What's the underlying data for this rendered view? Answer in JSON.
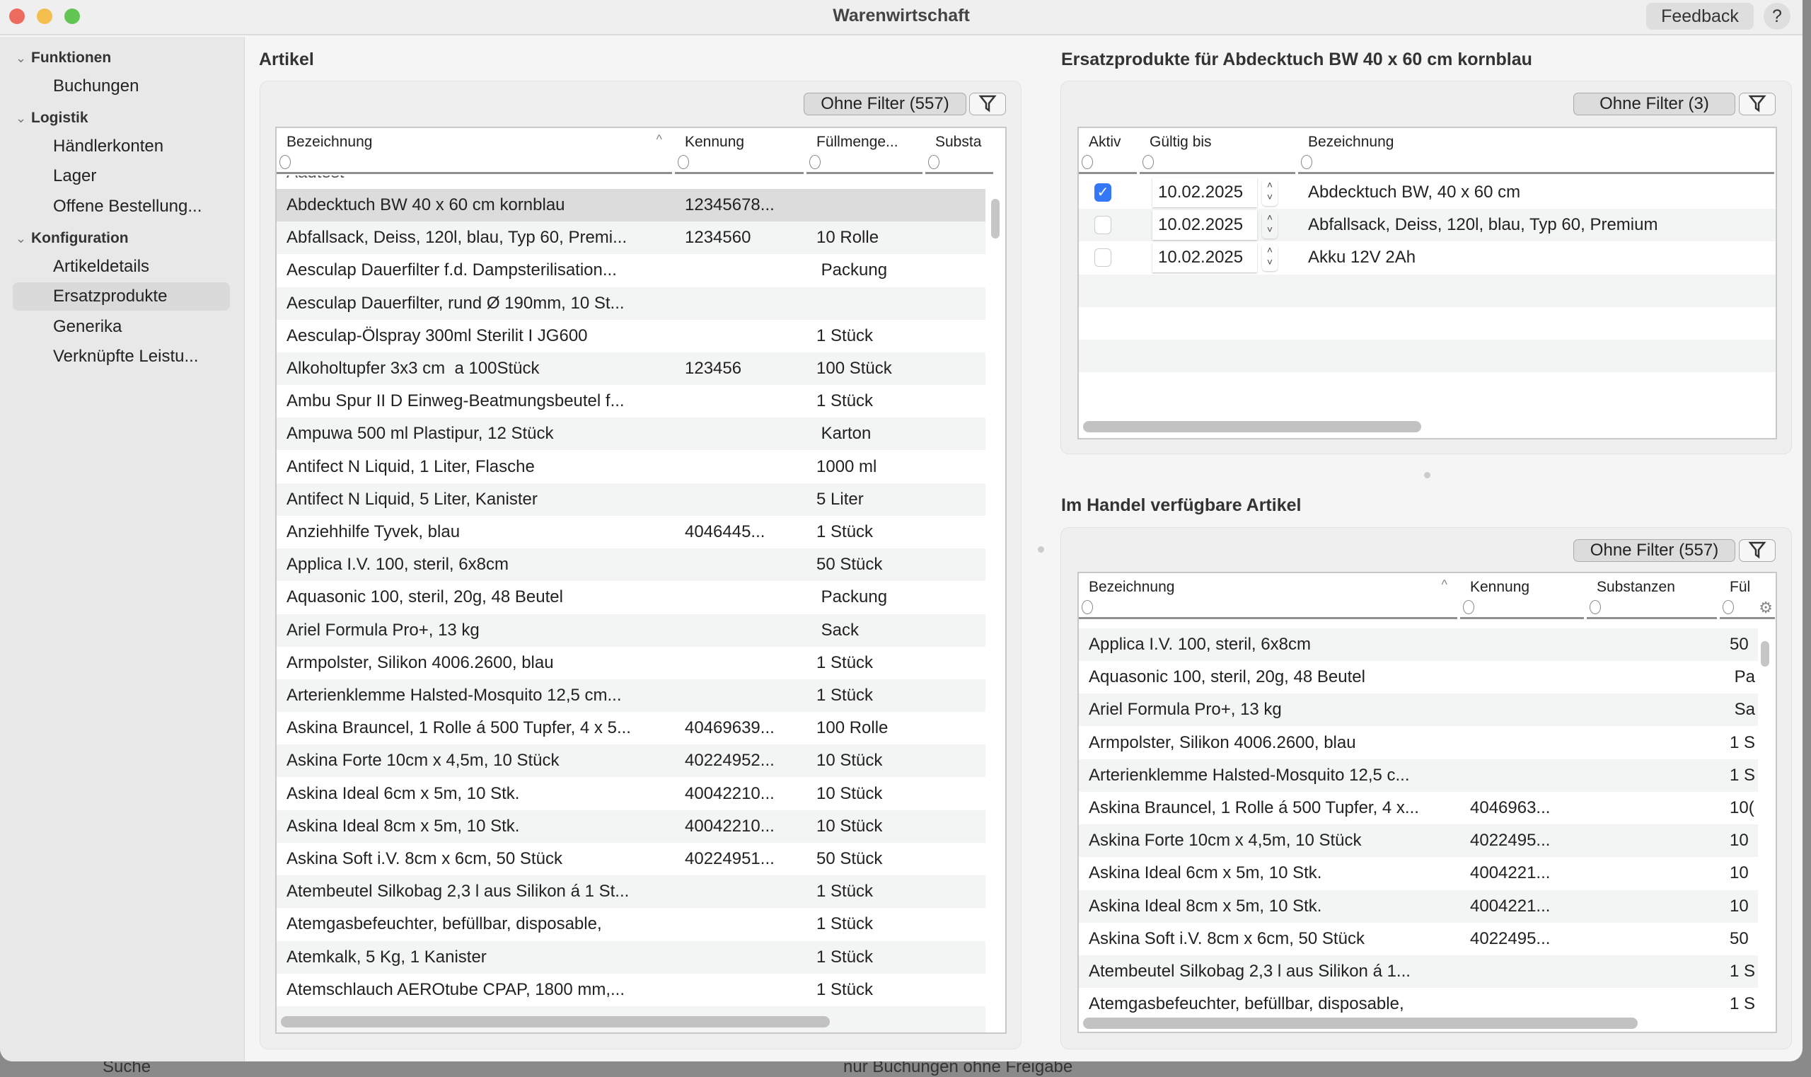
{
  "window": {
    "title": "Warenwirtschaft",
    "feedback_label": "Feedback",
    "help_label": "?"
  },
  "sidebar": {
    "groups": [
      {
        "label": "Funktionen",
        "items": [
          "Buchungen"
        ]
      },
      {
        "label": "Logistik",
        "items": [
          "Händlerkonten",
          "Lager",
          "Offene Bestellung..."
        ]
      },
      {
        "label": "Konfiguration",
        "items": [
          "Artikeldetails",
          "Ersatzprodukte",
          "Generika",
          "Verknüpfte Leistu..."
        ]
      }
    ],
    "selected": "Ersatzprodukte"
  },
  "artikel": {
    "heading": "Artikel",
    "filter_label": "Ohne Filter (557)",
    "columns": [
      "Bezeichnung",
      "Kennung",
      "Füllmenge...",
      "Substa"
    ],
    "partial_row": "Aadtest",
    "selected_index": 0,
    "rows": [
      [
        "Abdecktuch BW 40 x 60 cm kornblau",
        "12345678...",
        ""
      ],
      [
        "Abfallsack, Deiss, 120l, blau, Typ 60, Premi...",
        "1234560",
        "10 Rolle"
      ],
      [
        "Aesculap Dauerfilter f.d. Dampsterilisation...",
        "",
        " Packung"
      ],
      [
        "Aesculap Dauerfilter, rund Ø 190mm, 10 St...",
        "",
        ""
      ],
      [
        "Aesculap-Ölspray 300ml Sterilit I JG600",
        "",
        "1 Stück"
      ],
      [
        "Alkoholtupfer 3x3 cm  a 100Stück",
        "123456",
        "100 Stück"
      ],
      [
        "Ambu Spur II D Einweg-Beatmungsbeutel f...",
        "",
        "1 Stück"
      ],
      [
        "Ampuwa 500 ml Plastipur, 12 Stück",
        "",
        " Karton"
      ],
      [
        "Antifect N Liquid, 1 Liter, Flasche",
        "",
        "1000 ml"
      ],
      [
        "Antifect N Liquid, 5 Liter, Kanister",
        "",
        "5 Liter"
      ],
      [
        "Anziehhilfe Tyvek, blau",
        "4046445...",
        "1 Stück"
      ],
      [
        "Applica I.V. 100, steril, 6x8cm",
        "",
        "50 Stück"
      ],
      [
        "Aquasonic 100, steril, 20g, 48 Beutel",
        "",
        " Packung"
      ],
      [
        "Ariel Formula Pro+, 13 kg",
        "",
        " Sack"
      ],
      [
        "Armpolster, Silikon 4006.2600, blau",
        "",
        "1 Stück"
      ],
      [
        "Arterienklemme Halsted-Mosquito 12,5 cm...",
        "",
        "1 Stück"
      ],
      [
        "Askina Brauncel, 1 Rolle á 500 Tupfer, 4 x 5...",
        "40469639...",
        "100 Rolle"
      ],
      [
        "Askina Forte 10cm x 4,5m, 10 Stück",
        "40224952...",
        "10 Stück"
      ],
      [
        "Askina Ideal 6cm x 5m, 10 Stk.",
        "40042210...",
        "10 Stück"
      ],
      [
        "Askina Ideal 8cm x 5m, 10 Stk.",
        "40042210...",
        "10 Stück"
      ],
      [
        "Askina Soft i.V. 8cm x 6cm, 50 Stück",
        "40224951...",
        "50 Stück"
      ],
      [
        "Atembeutel Silkobag 2,3 l aus Silikon á 1 St...",
        "",
        "1 Stück"
      ],
      [
        "Atemgasbefeuchter, befüllbar, disposable,",
        "",
        "1 Stück"
      ],
      [
        "Atemkalk, 5 Kg, 1 Kanister",
        "",
        "1 Stück"
      ],
      [
        "Atemschlauch AEROtube CPAP, 1800 mm,...",
        "",
        "1 Stück"
      ]
    ]
  },
  "ersatz": {
    "heading": "Ersatzprodukte für Abdecktuch BW 40 x 60 cm kornblau",
    "filter_label": "Ohne Filter (3)",
    "columns": [
      "Aktiv",
      "Gültig bis",
      "Bezeichnung"
    ],
    "rows": [
      {
        "aktiv": true,
        "gueltig_bis": "10.02.2025",
        "bezeichnung": "Abdecktuch BW, 40 x 60 cm"
      },
      {
        "aktiv": false,
        "gueltig_bis": "10.02.2025",
        "bezeichnung": "Abfallsack, Deiss, 120l, blau, Typ 60, Premium"
      },
      {
        "aktiv": false,
        "gueltig_bis": "10.02.2025",
        "bezeichnung": "Akku 12V 2Ah"
      }
    ]
  },
  "handel": {
    "heading": "Im Handel verfügbare Artikel",
    "filter_label": "Ohne Filter (557)",
    "columns": [
      "Bezeichnung",
      "Kennung",
      "Substanzen",
      "Fül"
    ],
    "rows": [
      [
        "Applica I.V. 100, steril, 6x8cm",
        "",
        "",
        "50"
      ],
      [
        "Aquasonic 100, steril, 20g, 48 Beutel",
        "",
        "",
        " Pa"
      ],
      [
        "Ariel Formula Pro+, 13 kg",
        "",
        "",
        " Sa"
      ],
      [
        "Armpolster, Silikon 4006.2600, blau",
        "",
        "",
        "1 S"
      ],
      [
        "Arterienklemme Halsted-Mosquito 12,5 c...",
        "",
        "",
        "1 S"
      ],
      [
        "Askina Brauncel, 1 Rolle á 500 Tupfer, 4 x...",
        "4046963...",
        "",
        "10("
      ],
      [
        "Askina Forte 10cm x 4,5m, 10 Stück",
        "4022495...",
        "",
        "10"
      ],
      [
        "Askina Ideal 6cm x 5m, 10 Stk.",
        "4004221...",
        "",
        "10"
      ],
      [
        "Askina Ideal 8cm x 5m, 10 Stk.",
        "4004221...",
        "",
        "10"
      ],
      [
        "Askina Soft i.V. 8cm x 6cm, 50 Stück",
        "4022495...",
        "",
        "50"
      ],
      [
        "Atembeutel Silkobag 2,3 l aus Silikon á 1...",
        "",
        "",
        "1 S"
      ],
      [
        "Atemgasbefeuchter, befüllbar, disposable,",
        "",
        "",
        "1 S"
      ]
    ]
  },
  "background": {
    "search_label": "Suche",
    "status_text": "nur Buchungen ohne Freigabe"
  },
  "colors": {
    "accent": "#3478f6",
    "selection": "#dcdcdc",
    "close": "#ec6a5e",
    "minimize": "#f4bf4f",
    "zoom": "#61c554"
  }
}
